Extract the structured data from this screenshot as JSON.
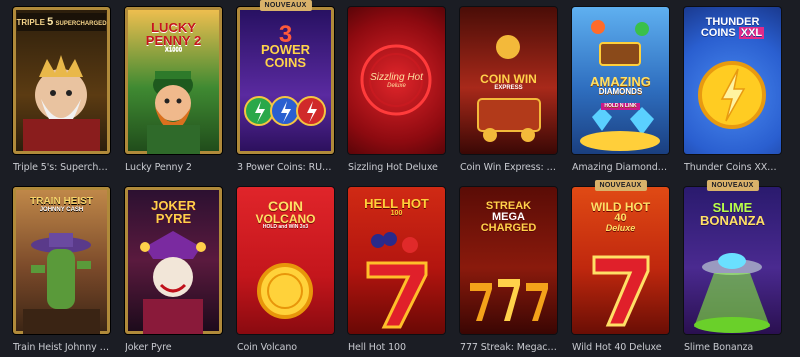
{
  "badge_label": "NOUVEAUX",
  "games": [
    {
      "caption": "Triple 5's: Supercharg...",
      "art_title": "TRIPLE",
      "art_sub": "SUPERCHARGED",
      "art_num": "5",
      "bg": "#3a2a12",
      "accent": "#e9b84a",
      "icon": "king-icon"
    },
    {
      "caption": "Lucky Penny 2",
      "art_title": "LUCKY",
      "art_sub": "PENNY",
      "art_num": "2",
      "art_x": "X1000",
      "bg": "#2f6a2a",
      "accent": "#f2c23a",
      "icon": "leprechaun-icon"
    },
    {
      "caption": "3 Power Coins: RUN...",
      "art_title": "POWER",
      "art_sub": "COINS",
      "art_num": "3",
      "bg": "#3a1e6e",
      "accent": "#f4c542",
      "icon": "lightning-coins-icon",
      "badge": true
    },
    {
      "caption": "Sizzling Hot Deluxe",
      "art_title": "Sizzling Hot",
      "art_sub": "Deluxe",
      "bg": "#b0101a",
      "accent": "#ffd23a",
      "icon": "sizzling-ring-icon"
    },
    {
      "caption": "Coin Win Express: H...",
      "art_title": "COIN WIN",
      "art_sub": "EXPRESS",
      "bg": "#7a1a0c",
      "accent": "#f3b93a",
      "icon": "train-icon"
    },
    {
      "caption": "Amazing Diamonds: ...",
      "art_title": "AMAZING",
      "art_sub": "DIAMONDS",
      "art_sub2": "HOLD N LINK",
      "bg": "#2f6fc0",
      "accent": "#ffcf3a",
      "icon": "diamond-chest-icon"
    },
    {
      "caption": "Thunder Coins XXL: ...",
      "art_title": "THUNDER",
      "art_sub": "COINS",
      "art_tag": "XXL",
      "bg": "#2a5fd0",
      "accent": "#ffcc22",
      "icon": "thunder-coin-icon"
    },
    {
      "caption": "Train Heist Johnny Cash",
      "art_title": "TRAIN HEIST",
      "art_sub": "JOHNNY CASH",
      "bg": "#7b4a2a",
      "accent": "#f6d36a",
      "icon": "cactus-cowboy-icon"
    },
    {
      "caption": "Joker Pyre",
      "art_title": "JOKER",
      "art_sub": "PYRE",
      "bg": "#5a1a3e",
      "accent": "#ffd04a",
      "icon": "joker-icon"
    },
    {
      "caption": "Coin Volcano",
      "art_title": "COIN",
      "art_sub": "VOLCANO",
      "art_sub2": "HOLD and WIN 3x3",
      "bg": "#c4161c",
      "accent": "#ffd23a",
      "icon": "gold-coin-icon"
    },
    {
      "caption": "Hell Hot 100",
      "art_title": "HELL HOT",
      "art_sub": "100",
      "bg": "#b3150f",
      "accent": "#ffbf2a",
      "icon": "seven-icon"
    },
    {
      "caption": "777 Streak: Megacha...",
      "art_title": "STREAK",
      "art_sub": "MEGA",
      "art_sub2": "CHARGED",
      "bg": "#8a1a0c",
      "accent": "#ffd24a",
      "icon": "triple-seven-icon"
    },
    {
      "caption": "Wild Hot 40 Deluxe",
      "art_title": "WILD HOT",
      "art_sub": "40",
      "art_sub2": "Deluxe",
      "bg": "#c0280e",
      "accent": "#ffe066",
      "icon": "seven-icon",
      "badge": true
    },
    {
      "caption": "Slime Bonanza",
      "art_title": "SLIME",
      "art_sub": "BONANZA",
      "bg": "#4a2a90",
      "accent": "#8cff3a",
      "icon": "ufo-icon",
      "badge": true
    }
  ]
}
